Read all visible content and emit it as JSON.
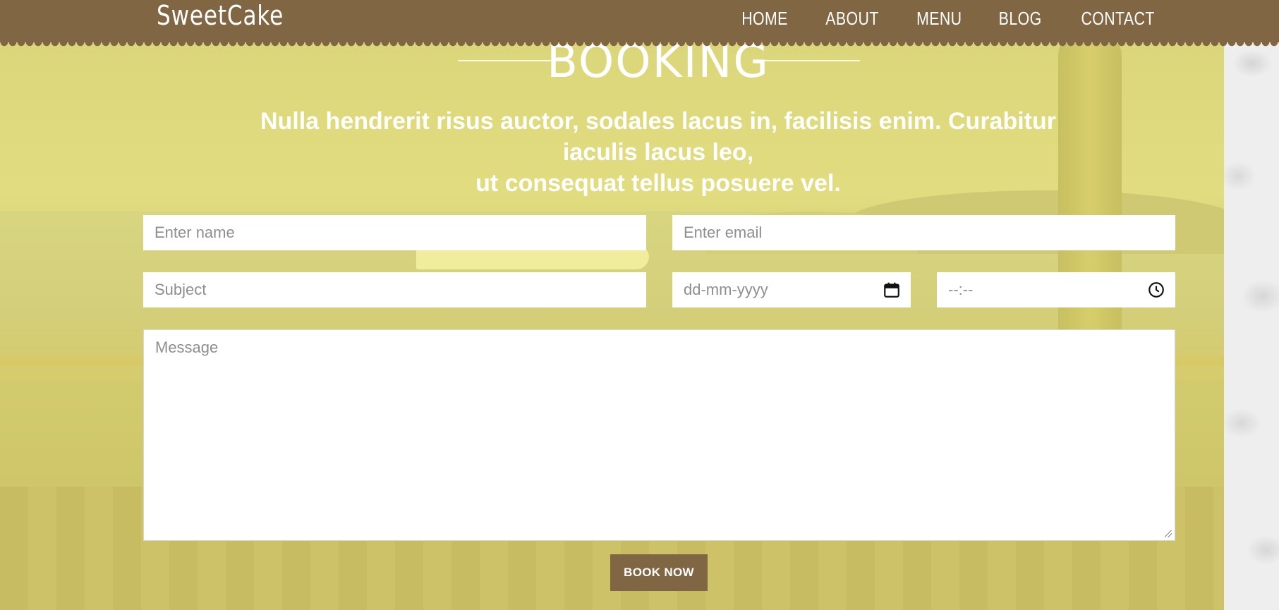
{
  "header": {
    "logo": "SweetCake",
    "nav": [
      "HOME",
      "ABOUT",
      "MENU",
      "BLOG",
      "CONTACT"
    ]
  },
  "booking": {
    "title": "BOOKING",
    "subtitle_line1": "Nulla hendrerit risus auctor, sodales lacus in, facilisis enim. Curabitur iaculis lacus leo,",
    "subtitle_line2": "ut consequat tellus posuere vel."
  },
  "form": {
    "name_placeholder": "Enter name",
    "email_placeholder": "Enter email",
    "subject_placeholder": "Subject",
    "date_placeholder": "dd-mm-yyyy",
    "time_placeholder": "--:--",
    "message_placeholder": "Message",
    "submit_label": "BOOK NOW"
  },
  "icons": {
    "date": "calendar-icon",
    "time": "clock-icon"
  },
  "colors": {
    "header_bg": "#806643",
    "button_bg": "#806643",
    "overlay": "#f6f078",
    "text_on_hero": "#ffffff"
  }
}
